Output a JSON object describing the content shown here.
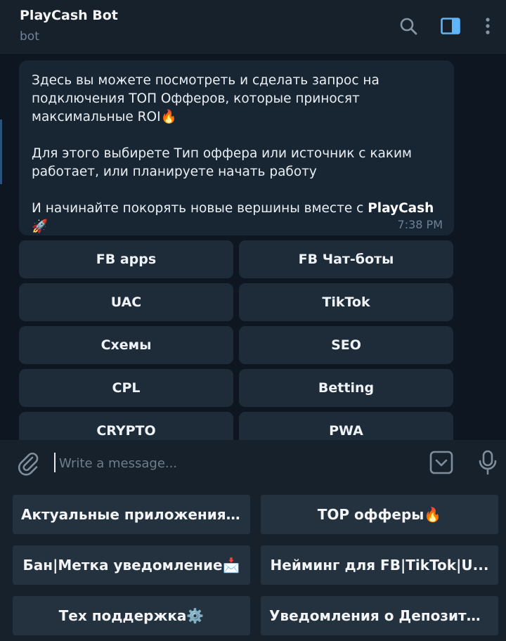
{
  "header": {
    "title": "PlayCash Bot",
    "subtitle": "bot",
    "icons": [
      "search-icon",
      "sidebar-toggle-icon",
      "more-vertical-icon"
    ]
  },
  "message": {
    "text_main": "Здесь вы можете посмотреть и сделать запрос на подключения ТОП Офферов, которые приносят максимальные ROI🔥\n\nДля этого выбирете Тип оффера или источник с каким работает, или планируете начать работу\n\nИ начинайте покорять новые вершины вместе с ",
    "text_brand": "PlayCash",
    "text_suffix": "🚀",
    "time": "7:38 PM"
  },
  "inline_keyboard": [
    {
      "label": "FB apps"
    },
    {
      "label": "FB Чат-боты"
    },
    {
      "label": "UAC"
    },
    {
      "label": "TikTok"
    },
    {
      "label": "Схемы"
    },
    {
      "label": "SEO"
    },
    {
      "label": "CPL"
    },
    {
      "label": "Betting"
    },
    {
      "label": "CRYPTO"
    },
    {
      "label": "PWA"
    }
  ],
  "composer": {
    "placeholder": "Write a message...",
    "value": "",
    "icons": [
      "paperclip-icon",
      "bot-keyboard-icon",
      "microphone-icon"
    ]
  },
  "reply_keyboard": [
    {
      "label": "Актуальные приложения..."
    },
    {
      "label": "TOP офферы🔥"
    },
    {
      "label": "Бан|Метка уведомление📩"
    },
    {
      "label": "Нейминг для FB|TikTok|U..."
    },
    {
      "label": "Тех поддержка⚙️"
    },
    {
      "label": "Уведомления о Депозита..."
    }
  ],
  "colors": {
    "background": "#0e1621",
    "header": "#17212b",
    "bubble": "#182533",
    "inline_button": "#1e2c3a",
    "reply_button": "#243240",
    "accent": "#5eb5f7"
  }
}
